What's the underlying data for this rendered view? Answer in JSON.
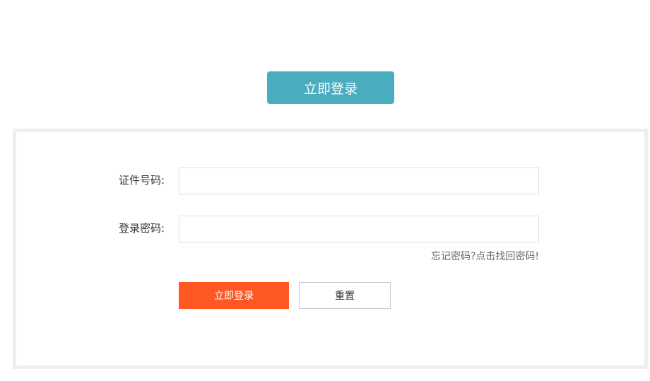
{
  "header": {
    "login_button_label": "立即登录"
  },
  "form": {
    "id_label": "证件号码:",
    "id_value": "",
    "password_label": "登录密码:",
    "password_value": "",
    "forgot_link": "忘记密码?点击找回密码!",
    "submit_label": "立即登录",
    "reset_label": "重置"
  },
  "colors": {
    "header_button": "#4aacbf",
    "submit_button": "#ff5722",
    "panel_border": "#efefef"
  }
}
